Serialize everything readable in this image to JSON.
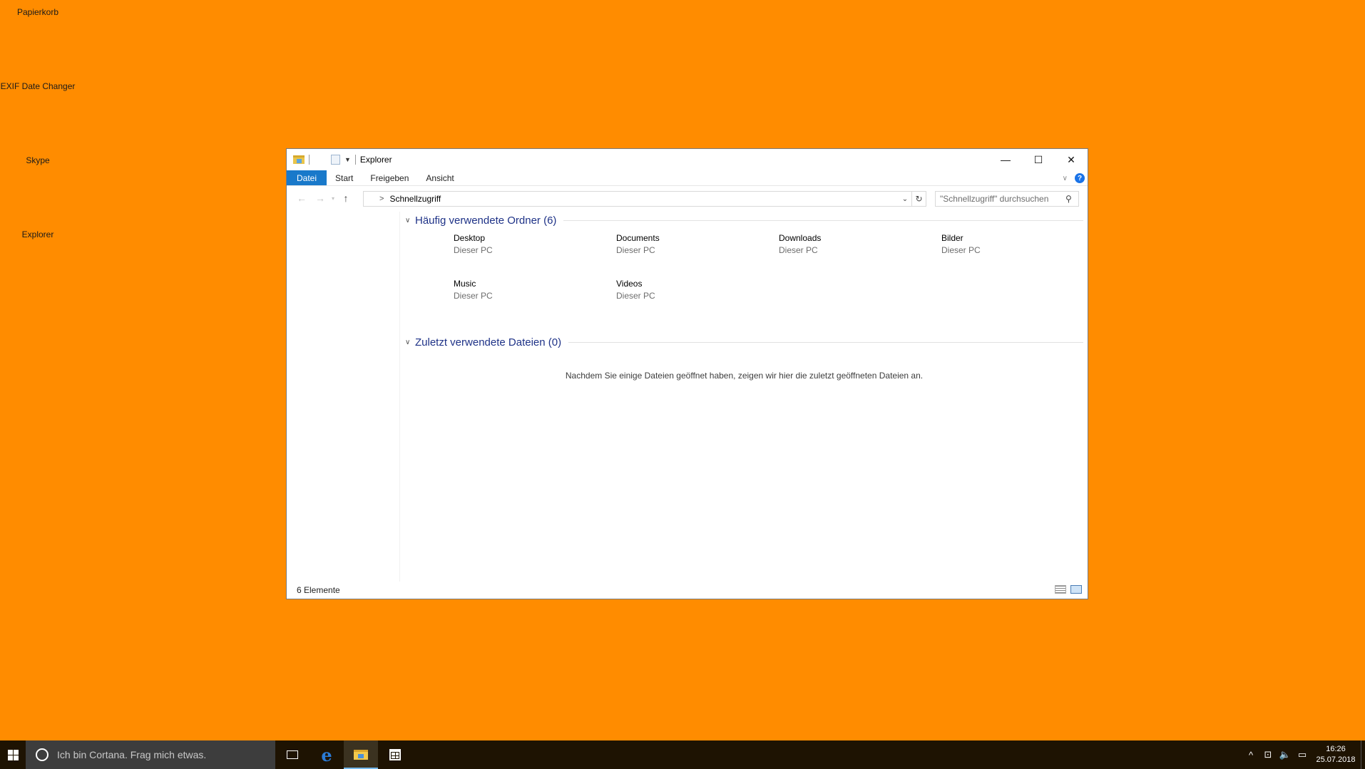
{
  "desktop": {
    "icons": [
      {
        "label": "Papierkorb"
      },
      {
        "label": "EXIF Date Changer"
      },
      {
        "label": "Skype"
      },
      {
        "label": "Explorer"
      }
    ]
  },
  "window": {
    "title": "Explorer",
    "controls": {
      "minimize": "—",
      "maximize": "☐",
      "close": "✕"
    },
    "ribbon": {
      "tabs": [
        "Datei",
        "Start",
        "Freigeben",
        "Ansicht"
      ],
      "help": "?"
    },
    "navbar": {
      "back": "←",
      "forward": "→",
      "recent": "▾",
      "up": "↑",
      "crumb_separator": ">",
      "location": "Schnellzugriff",
      "refresh": "↻",
      "search_placeholder": "\"Schnellzugriff\" durchsuchen",
      "search_icon": "⚲"
    },
    "groups": {
      "frequent": {
        "header": "Häufig verwendete Ordner (6)",
        "items": [
          {
            "name": "Desktop",
            "location": "Dieser PC"
          },
          {
            "name": "Documents",
            "location": "Dieser PC"
          },
          {
            "name": "Downloads",
            "location": "Dieser PC"
          },
          {
            "name": "Bilder",
            "location": "Dieser PC"
          },
          {
            "name": "Music",
            "location": "Dieser PC"
          },
          {
            "name": "Videos",
            "location": "Dieser PC"
          }
        ]
      },
      "recent": {
        "header": "Zuletzt verwendete Dateien (0)",
        "empty_message": "Nachdem Sie einige Dateien geöffnet haben, zeigen wir hier die zuletzt geöffneten Dateien an."
      }
    },
    "status": {
      "item_count": "6 Elemente"
    }
  },
  "taskbar": {
    "cortana_placeholder": "Ich bin Cortana. Frag mich etwas.",
    "edge_glyph": "e",
    "tray": {
      "chevron": "^",
      "network": "⊡",
      "volume": "🔈",
      "notifications": "▭"
    },
    "clock": {
      "time": "16:26",
      "date": "25.07.2018"
    }
  }
}
